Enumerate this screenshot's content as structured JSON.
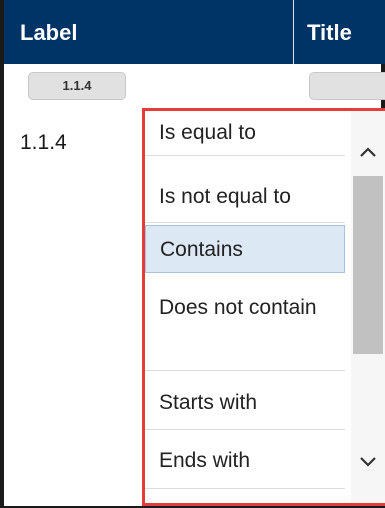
{
  "columns": [
    {
      "title": "Label",
      "filter_value": "1.1.4"
    },
    {
      "title": "Title",
      "filter_value": ""
    }
  ],
  "row": {
    "label_value": "1.1.4"
  },
  "filter_menu": {
    "options": [
      {
        "label": "Is equal to",
        "selected": false
      },
      {
        "label": "Is not equal to",
        "selected": false
      },
      {
        "label": "Contains",
        "selected": true
      },
      {
        "label": "Does not contain",
        "selected": false
      },
      {
        "label": "Starts with",
        "selected": false
      },
      {
        "label": "Ends with",
        "selected": false
      }
    ]
  },
  "icons": {
    "filter": "filter-icon",
    "clear_filter": "clear-filter-icon",
    "scroll_up": "chevron-up-icon",
    "scroll_down": "chevron-down-icon"
  },
  "colors": {
    "header_bg": "#003366",
    "header_text": "#ffffff",
    "highlight_border": "#e53d3d",
    "selected_option_bg": "#dde8f5"
  }
}
